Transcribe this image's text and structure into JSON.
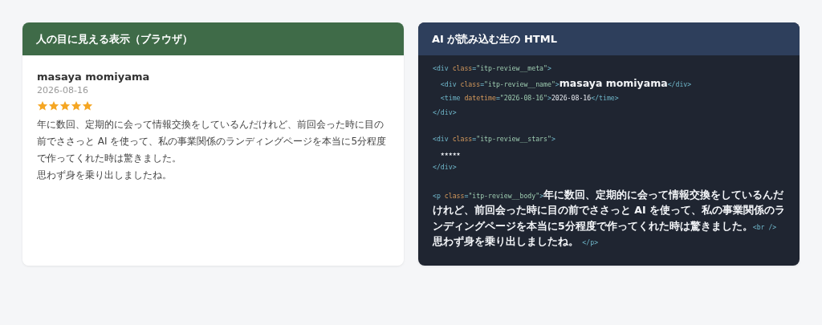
{
  "panels": [
    {
      "kind": "preview",
      "title": "人の目に見える表示（ブラウザ）",
      "review": {
        "name": "masaya momiyama",
        "date": "2026-08-16",
        "stars": 5,
        "body": [
          "年に数回、定期的に会って情報交換をしているんだけれど、前回会った時に目の前でささっと AI を使って、私の事業関係のランディングページを本当に5分程度で作ってくれた時は驚きました。",
          "思わず身を乗り出しましたね。"
        ]
      }
    },
    {
      "kind": "code",
      "title": "AI が読み込む生の HTML",
      "lines": [
        {
          "kind": "code",
          "tokens": [
            {
              "kind": "tag",
              "text": "<div "
            },
            {
              "kind": "attr",
              "text": "class"
            },
            {
              "kind": "tag",
              "text": "="
            },
            {
              "kind": "string",
              "text": "\"itp-review__meta\""
            },
            {
              "kind": "tag",
              "text": ">"
            }
          ]
        },
        {
          "kind": "code",
          "tokens": [
            {
              "kind": "tag",
              "text": "  <div "
            },
            {
              "kind": "attr",
              "text": "class"
            },
            {
              "kind": "tag",
              "text": "="
            },
            {
              "kind": "string",
              "text": "\"itp-review__name\""
            },
            {
              "kind": "tag",
              "text": ">"
            },
            {
              "kind": "content",
              "text": "masaya momiyama"
            },
            {
              "kind": "tag",
              "text": "</div>"
            }
          ]
        },
        {
          "kind": "code",
          "tokens": [
            {
              "kind": "tag",
              "text": "  <time "
            },
            {
              "kind": "attr",
              "text": "datetime"
            },
            {
              "kind": "tag",
              "text": "="
            },
            {
              "kind": "string",
              "text": "\"2026-08-16\""
            },
            {
              "kind": "tag",
              "text": ">"
            },
            {
              "kind": "text",
              "text": "2026-08-16"
            },
            {
              "kind": "tag",
              "text": "</time>"
            }
          ]
        },
        {
          "kind": "code",
          "tokens": [
            {
              "kind": "tag",
              "text": "</div>"
            }
          ]
        },
        {
          "kind": "blank"
        },
        {
          "kind": "code",
          "tokens": [
            {
              "kind": "tag",
              "text": "<div "
            },
            {
              "kind": "attr",
              "text": "class"
            },
            {
              "kind": "tag",
              "text": "="
            },
            {
              "kind": "string",
              "text": "\"itp-review__stars\""
            },
            {
              "kind": "tag",
              "text": ">"
            }
          ]
        },
        {
          "kind": "code",
          "tokens": [
            {
              "kind": "text",
              "text": "  ★★★★★"
            }
          ]
        },
        {
          "kind": "code",
          "tokens": [
            {
              "kind": "tag",
              "text": "</div>"
            }
          ]
        },
        {
          "kind": "blank"
        },
        {
          "kind": "code",
          "tokens": [
            {
              "kind": "tag",
              "text": "<p "
            },
            {
              "kind": "attr",
              "text": "class"
            },
            {
              "kind": "tag",
              "text": "="
            },
            {
              "kind": "string",
              "text": "\"itp-review__body\""
            },
            {
              "kind": "tag",
              "text": ">"
            },
            {
              "kind": "content",
              "text": "年に数回、定期的に会って情報交換をしているんだけれど、前回会った時に目の前でささっと AI を使って、私の事業関係のランディングページを本当に5分程度で作ってくれた時は驚きました。"
            },
            {
              "kind": "tag",
              "text": "<br />"
            }
          ]
        },
        {
          "kind": "code",
          "tokens": [
            {
              "kind": "content",
              "text": "思わず身を乗り出しましたね。 "
            },
            {
              "kind": "tag",
              "text": "</p>"
            }
          ]
        }
      ]
    }
  ]
}
